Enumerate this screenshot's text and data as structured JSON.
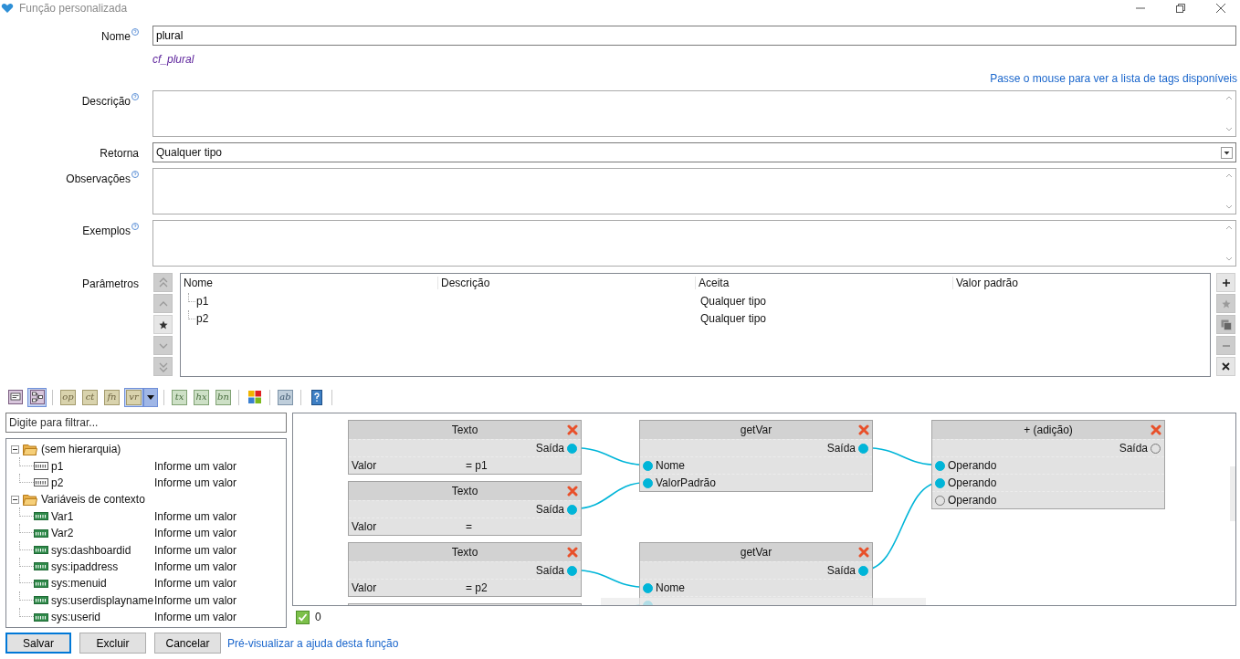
{
  "window": {
    "title": "Função personalizada"
  },
  "form": {
    "name": {
      "label": "Nome",
      "value": "plural",
      "identifier": "cf_plural"
    },
    "tags_link": "Passe o mouse para ver a lista de tags disponíveis",
    "description": {
      "label": "Descrição"
    },
    "returns": {
      "label": "Retorna",
      "value": "Qualquer tipo"
    },
    "notes": {
      "label": "Observações"
    },
    "examples": {
      "label": "Exemplos"
    },
    "parameters": {
      "label": "Parâmetros",
      "move_buttons": [
        {
          "kind": "top",
          "disabled": true
        },
        {
          "kind": "up",
          "disabled": true
        },
        {
          "kind": "star",
          "disabled": false
        },
        {
          "kind": "down",
          "disabled": true
        },
        {
          "kind": "bottom",
          "disabled": true
        }
      ],
      "columns": [
        "Nome",
        "Descrição",
        "Aceita",
        "Valor padrão"
      ],
      "rows": [
        {
          "name": "p1",
          "accepts": "Qualquer tipo"
        },
        {
          "name": "p2",
          "accepts": "Qualquer tipo"
        }
      ],
      "edit_buttons": [
        {
          "kind": "add",
          "disabled": false
        },
        {
          "kind": "star",
          "disabled": true
        },
        {
          "kind": "copy",
          "disabled": true
        },
        {
          "kind": "remove",
          "disabled": true
        },
        {
          "kind": "clear",
          "disabled": false
        }
      ]
    }
  },
  "toolbar": {
    "groups": [
      {
        "items": [
          {
            "kind": "form-view",
            "selected": false
          },
          {
            "kind": "diagram-view",
            "selected": true
          }
        ]
      },
      {
        "items": [
          {
            "kind": "tag",
            "label": "op",
            "color": "#d9d3ad",
            "selected": false
          },
          {
            "kind": "tag",
            "label": "ct",
            "color": "#d9d3ad",
            "selected": false
          },
          {
            "kind": "tag",
            "label": "fn",
            "color": "#d9d3ad",
            "selected": false
          },
          {
            "kind": "tag",
            "label": "vr",
            "color": "#d9d3ad",
            "selected": true
          },
          {
            "kind": "dropdown",
            "selected": true
          }
        ]
      },
      {
        "items": [
          {
            "kind": "tag",
            "label": "tx",
            "color": "#cde0c6",
            "selected": false
          },
          {
            "kind": "tag",
            "label": "hx",
            "color": "#cde0c6",
            "selected": false
          },
          {
            "kind": "tag",
            "label": "bn",
            "color": "#cde0c6",
            "selected": false
          }
        ]
      },
      {
        "items": [
          {
            "kind": "palette",
            "selected": false
          }
        ]
      },
      {
        "items": [
          {
            "kind": "tag",
            "label": "ab",
            "color": "#bfcedb",
            "selected": false
          }
        ]
      },
      {
        "items": [
          {
            "kind": "help",
            "selected": false
          }
        ]
      }
    ]
  },
  "filter": {
    "placeholder": "Digite para filtrar..."
  },
  "tree": [
    {
      "label": "(sem hierarquia)",
      "expanded": true,
      "children": [
        {
          "name": "p1",
          "value": "Informe um valor",
          "kind": "parameter"
        },
        {
          "name": "p2",
          "value": "Informe um valor",
          "kind": "parameter"
        }
      ]
    },
    {
      "label": "Variáveis de contexto",
      "expanded": true,
      "children": [
        {
          "name": "Var1",
          "value": "Informe um valor",
          "kind": "context"
        },
        {
          "name": "Var2",
          "value": "Informe um valor",
          "kind": "context"
        },
        {
          "name": "sys:dashboardid",
          "value": "Informe um valor",
          "kind": "context"
        },
        {
          "name": "sys:ipaddress",
          "value": "Informe um valor",
          "kind": "context"
        },
        {
          "name": "sys:menuid",
          "value": "Informe um valor",
          "kind": "context"
        },
        {
          "name": "sys:userdisplayname",
          "value": "Informe um valor",
          "kind": "context"
        },
        {
          "name": "sys:userid",
          "value": "Informe um valor",
          "kind": "context"
        }
      ]
    }
  ],
  "nodes": [
    {
      "title": "Texto",
      "rows": [
        {
          "kind": "output",
          "label": "Saída",
          "connected": true
        },
        {
          "kind": "value",
          "label": "Valor",
          "value": "= p1"
        }
      ]
    },
    {
      "title": "Texto",
      "rows": [
        {
          "kind": "output",
          "label": "Saída",
          "connected": true
        },
        {
          "kind": "value",
          "label": "Valor",
          "value": "="
        }
      ]
    },
    {
      "title": "Texto",
      "rows": [
        {
          "kind": "output",
          "label": "Saída",
          "connected": true
        },
        {
          "kind": "value",
          "label": "Valor",
          "value": "= p2"
        }
      ]
    },
    {
      "title": "getVar",
      "rows": [
        {
          "kind": "output",
          "label": "Saída",
          "connected": true
        },
        {
          "kind": "input",
          "label": "Nome",
          "connected": true
        },
        {
          "kind": "input",
          "label": "ValorPadrão",
          "connected": true
        }
      ]
    },
    {
      "title": "getVar",
      "rows": [
        {
          "kind": "output",
          "label": "Saída",
          "connected": true
        },
        {
          "kind": "input",
          "label": "Nome",
          "connected": true
        },
        {
          "kind": "input",
          "connected": true
        }
      ]
    },
    {
      "title": "+ (adição)",
      "rows": [
        {
          "kind": "output",
          "label": "Saída",
          "connected": false
        },
        {
          "kind": "input",
          "label": "Operando",
          "connected": true
        },
        {
          "kind": "input",
          "label": "Operando",
          "connected": true
        },
        {
          "kind": "input",
          "label": "Operando",
          "connected": false
        }
      ]
    }
  ],
  "status": {
    "checked": true,
    "count": "0"
  },
  "buttons": [
    {
      "label": "Salvar",
      "default": true
    },
    {
      "label": "Excluir",
      "default": false
    },
    {
      "label": "Cancelar",
      "default": false
    }
  ],
  "help_link": "Pré-visualizar a ajuda desta função"
}
